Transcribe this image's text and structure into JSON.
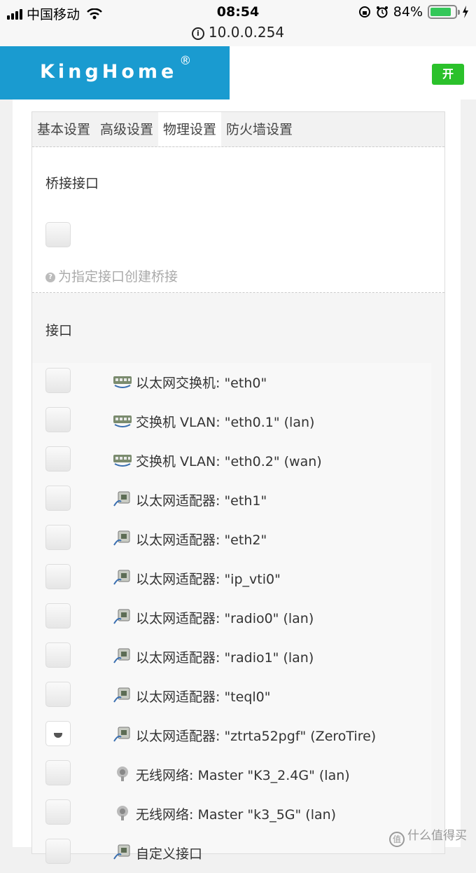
{
  "status_bar": {
    "carrier": "中国移动",
    "time": "08:54",
    "battery_percent": "84%",
    "battery_level": 0.84
  },
  "url_bar": {
    "url": "10.0.0.254"
  },
  "header": {
    "brand": "KingHome",
    "brand_mark": "®",
    "toggle_label": "开",
    "brand_color": "#1a9bd0",
    "toggle_color": "#2bc12b"
  },
  "tabs": [
    {
      "label": "基本设置",
      "active": false
    },
    {
      "label": "高级设置",
      "active": false
    },
    {
      "label": "物理设置",
      "active": true
    },
    {
      "label": "防火墙设置",
      "active": false
    }
  ],
  "bridge_section": {
    "title": "桥接接口",
    "checked": false,
    "hint": "为指定接口创建桥接"
  },
  "interfaces_section": {
    "title": "接口",
    "items": [
      {
        "label": "以太网交换机: \"eth0\"",
        "icon": "switch-icon",
        "checked": false
      },
      {
        "label": "交换机 VLAN: \"eth0.1\" (lan)",
        "icon": "switch-icon",
        "checked": false
      },
      {
        "label": "交换机 VLAN: \"eth0.2\" (wan)",
        "icon": "switch-icon",
        "checked": false
      },
      {
        "label": "以太网适配器: \"eth1\"",
        "icon": "ethernet-adapter-icon",
        "checked": false
      },
      {
        "label": "以太网适配器: \"eth2\"",
        "icon": "ethernet-adapter-icon",
        "checked": false
      },
      {
        "label": "以太网适配器: \"ip_vti0\"",
        "icon": "ethernet-adapter-icon",
        "checked": false
      },
      {
        "label": "以太网适配器: \"radio0\" (lan)",
        "icon": "ethernet-adapter-icon",
        "checked": false
      },
      {
        "label": "以太网适配器: \"radio1\" (lan)",
        "icon": "ethernet-adapter-icon",
        "checked": false
      },
      {
        "label": "以太网适配器: \"teql0\"",
        "icon": "ethernet-adapter-icon",
        "checked": false
      },
      {
        "label": "以太网适配器: \"ztrta52pgf\" (ZeroTire)",
        "icon": "ethernet-adapter-icon",
        "checked": true
      },
      {
        "label": "无线网络: Master \"K3_2.4G\" (lan)",
        "icon": "wireless-icon",
        "checked": false
      },
      {
        "label": "无线网络: Master \"k3_5G\" (lan)",
        "icon": "wireless-icon",
        "checked": false
      },
      {
        "label": "自定义接口",
        "icon": "ethernet-adapter-icon",
        "checked": false
      }
    ]
  },
  "watermark": {
    "text": "什么值得买",
    "icon": "watermark-logo-icon"
  }
}
